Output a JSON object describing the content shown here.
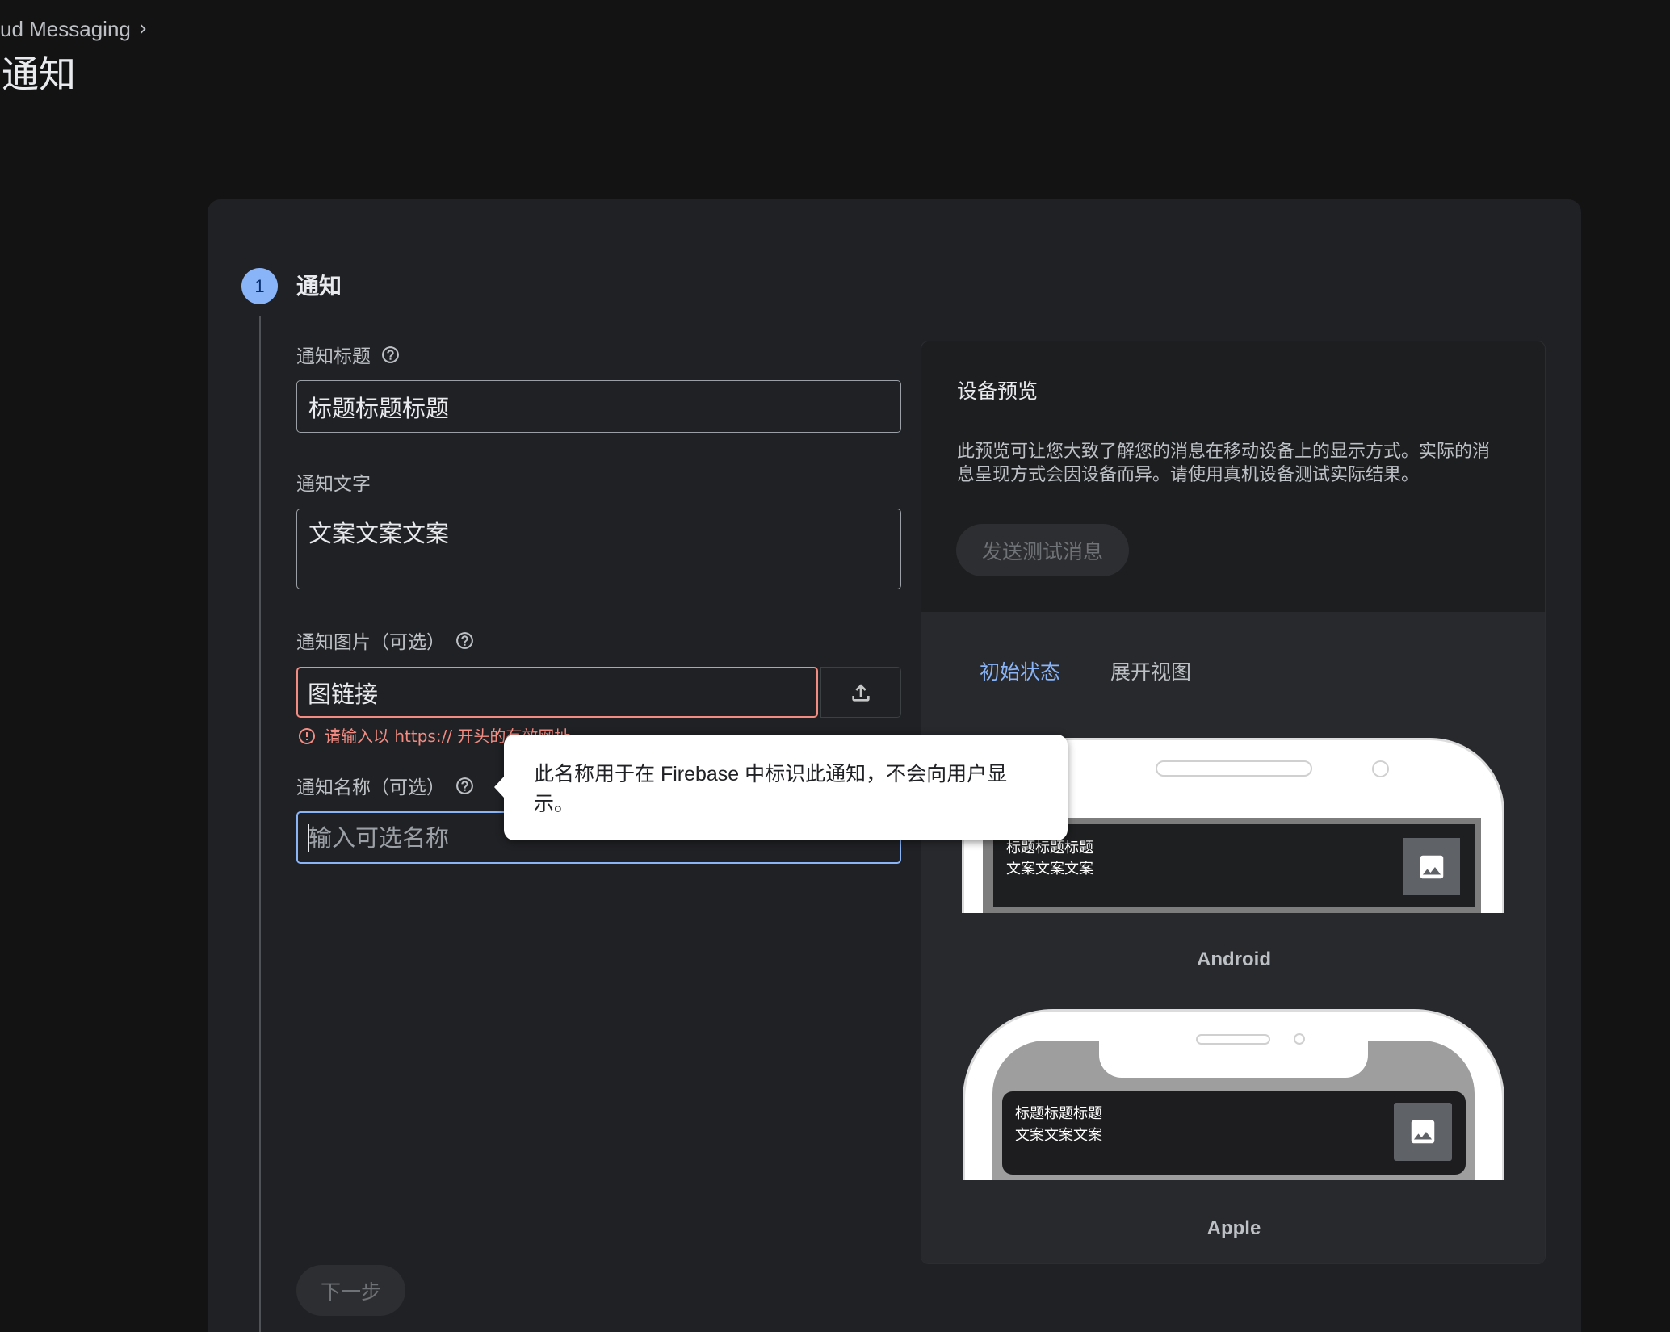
{
  "header": {
    "breadcrumb": "ud Messaging",
    "title": "通知"
  },
  "step": {
    "number": "1",
    "title": "通知"
  },
  "form": {
    "title_field": {
      "label": "通知标题",
      "value": "标题标题标题"
    },
    "text_field": {
      "label": "通知文字",
      "value": "文案文案文案"
    },
    "image_field": {
      "label": "通知图片（可选）",
      "value": "图链接",
      "error": "请输入以 https:// 开头的有效网址"
    },
    "name_field": {
      "label": "通知名称（可选）",
      "placeholder": "输入可选名称"
    },
    "next_button": "下一步"
  },
  "tooltip": {
    "text": "此名称用于在 Firebase 中标识此通知，不会向用户显示。"
  },
  "preview": {
    "title": "设备预览",
    "description": "此预览可让您大致了解您的消息在移动设备上的显示方式。实际的消息呈现方式会因设备而异。请使用真机设备测试实际结果。",
    "send_test_button": "发送测试消息",
    "tabs": [
      {
        "label": "初始状态",
        "active": true
      },
      {
        "label": "展开视图",
        "active": false
      }
    ],
    "devices": [
      {
        "name": "Android",
        "notification": {
          "title": "标题标题标题",
          "body": "文案文案文案"
        }
      },
      {
        "name": "Apple",
        "notification": {
          "title": "标题标题标题",
          "body": "文案文案文案"
        }
      }
    ]
  },
  "colors": {
    "page_background": "#131314",
    "card_background": "#202124",
    "accent": "#8ab4f8",
    "error": "#f28b82",
    "label_text": "#bdc1c6",
    "disabled_text": "#6f7276"
  },
  "icons": {
    "breadcrumb_separator": "chevron-right-icon",
    "field_help": "help-icon",
    "upload": "upload-icon",
    "error": "error-icon",
    "notification_image": "image-icon"
  }
}
